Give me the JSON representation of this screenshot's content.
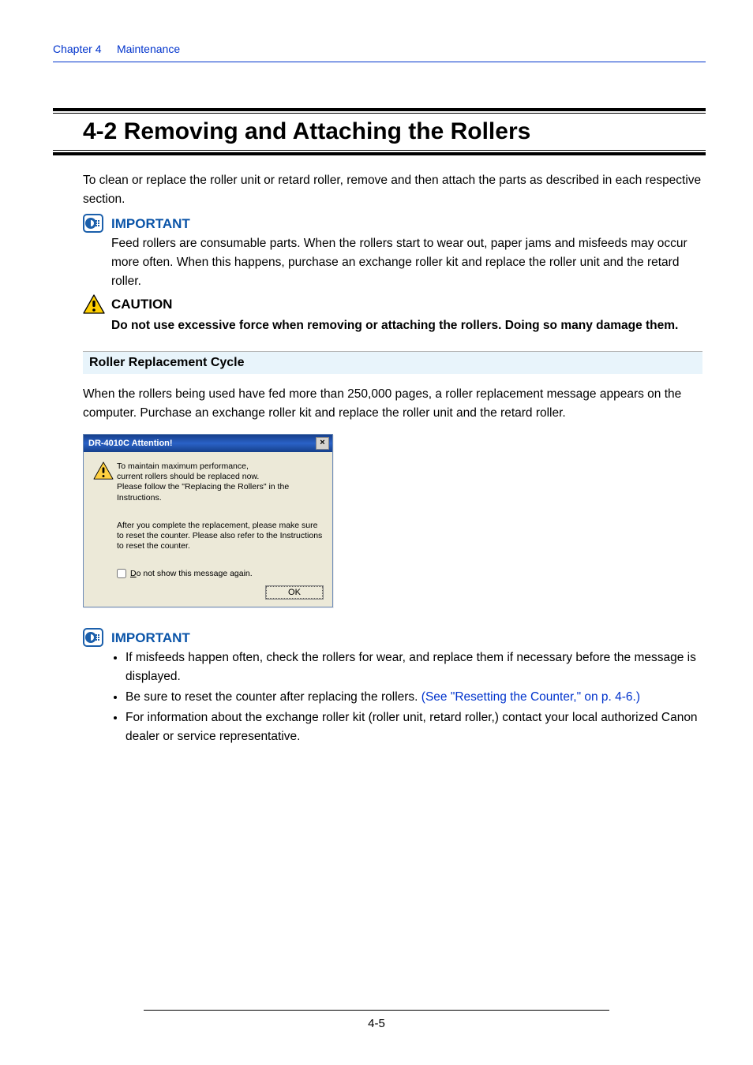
{
  "header": {
    "chapter_link": "Chapter 4",
    "chapter_title": "Maintenance"
  },
  "section": {
    "number_title": "4-2  Removing and Attaching the Rollers",
    "intro": "To clean or replace the roller unit or retard roller, remove and then attach the parts as described in each respective section."
  },
  "important1": {
    "label": "IMPORTANT",
    "text": "Feed rollers are consumable parts. When the rollers start to wear out, paper jams and misfeeds may occur more often. When this happens, purchase an exchange roller kit and replace the roller unit and the retard roller."
  },
  "caution": {
    "label": "CAUTION",
    "text": "Do not use excessive force when removing or attaching the rollers. Doing so many damage them."
  },
  "subhead": "Roller Replacement Cycle",
  "cycle_text": "When the rollers being used have fed more than 250,000 pages, a roller replacement message appears on the computer. Purchase an exchange roller kit and replace the roller unit and the retard roller.",
  "dialog": {
    "title": "DR-4010C Attention!",
    "msg1_l1": "To maintain maximum performance,",
    "msg1_l2": "current rollers should be replaced now.",
    "msg1_l3": "Please follow the \"Replacing the Rollers\" in the Instructions.",
    "msg2": "After you complete the replacement, please make sure to reset the counter. Please also refer to the Instructions to reset the counter.",
    "checkbox_label": "Do not show this message again.",
    "ok": "OK"
  },
  "important2": {
    "label": "IMPORTANT",
    "bullet1": "If misfeeds happen often, check the rollers for wear, and replace them if necessary before the message is displayed.",
    "bullet2_pre": "Be sure to reset the counter after replacing the rollers. ",
    "bullet2_link": "(See \"Resetting the Counter,\" on p. 4-6.)",
    "bullet3": "For information about the exchange roller kit (roller unit, retard roller,) contact your local authorized Canon dealer or service representative."
  },
  "footer": {
    "page": "4-5"
  }
}
